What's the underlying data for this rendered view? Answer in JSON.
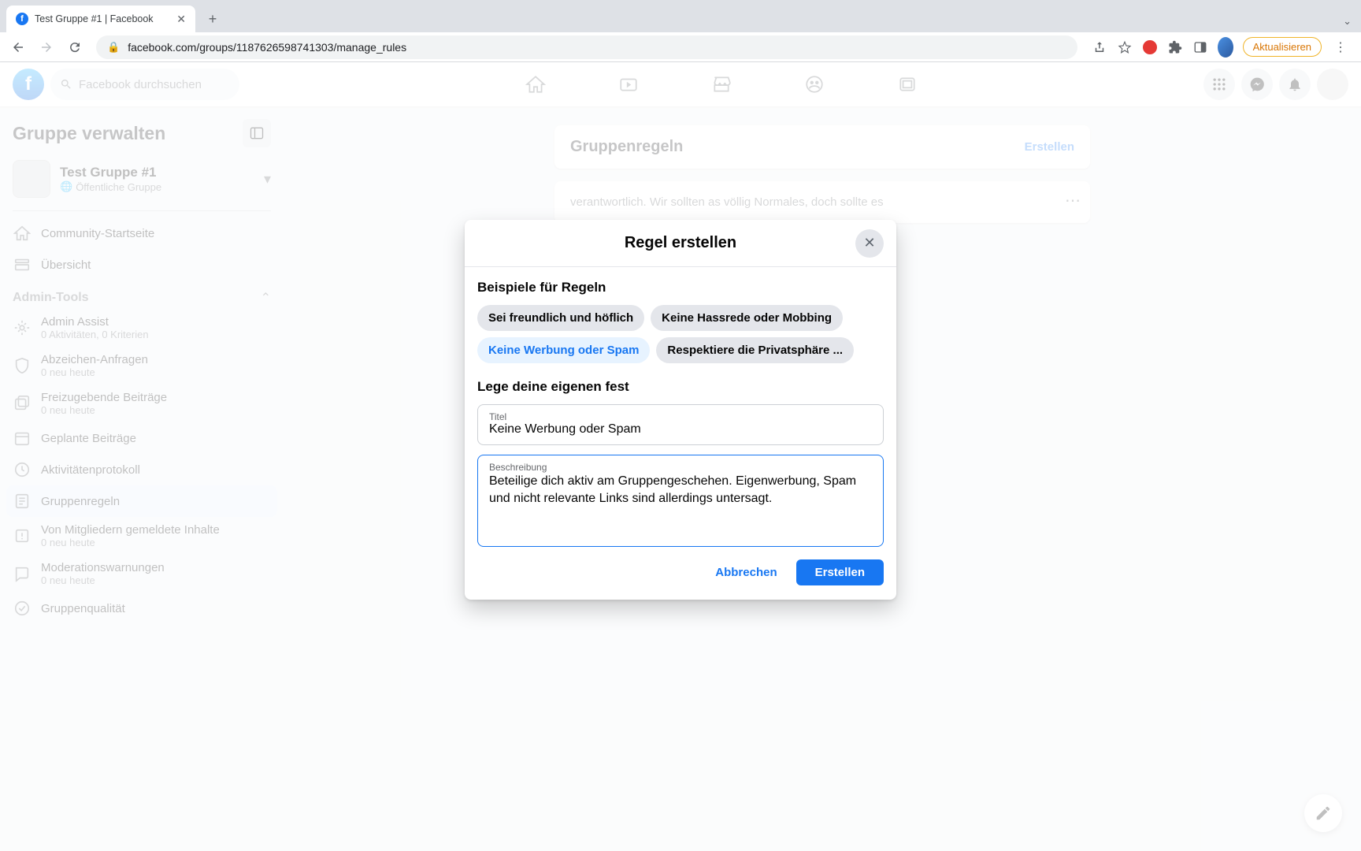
{
  "browser": {
    "tab_title": "Test Gruppe #1 | Facebook",
    "url": "facebook.com/groups/1187626598741303/manage_rules",
    "update_label": "Aktualisieren"
  },
  "fb": {
    "search_placeholder": "Facebook durchsuchen"
  },
  "sidebar": {
    "title": "Gruppe verwalten",
    "group_name": "Test Gruppe #1",
    "group_visibility": "Öffentliche Gruppe",
    "items": [
      {
        "label": "Community-Startseite",
        "sub": ""
      },
      {
        "label": "Übersicht",
        "sub": ""
      }
    ],
    "section_title": "Admin-Tools",
    "admin_items": [
      {
        "label": "Admin Assist",
        "sub": "0 Aktivitäten, 0 Kriterien"
      },
      {
        "label": "Abzeichen-Anfragen",
        "sub": "0 neu heute"
      },
      {
        "label": "Freizugebende Beiträge",
        "sub": "0 neu heute"
      },
      {
        "label": "Geplante Beiträge",
        "sub": ""
      },
      {
        "label": "Aktivitätenprotokoll",
        "sub": ""
      },
      {
        "label": "Gruppenregeln",
        "sub": ""
      },
      {
        "label": "Von Mitgliedern gemeldete Inhalte",
        "sub": "0 neu heute"
      },
      {
        "label": "Moderationswarnungen",
        "sub": "0 neu heute"
      },
      {
        "label": "Gruppenqualität",
        "sub": ""
      }
    ]
  },
  "main": {
    "card_title": "Gruppenregeln",
    "create_label": "Erstellen",
    "rule_snippet": "verantwortlich. Wir sollten as völlig Normales, doch sollte es"
  },
  "modal": {
    "title": "Regel erstellen",
    "examples_title": "Beispiele für Regeln",
    "chips": [
      "Sei freundlich und höflich",
      "Keine Hassrede oder Mobbing",
      "Keine Werbung oder Spam",
      "Respektiere die Privatsphäre ..."
    ],
    "custom_title": "Lege deine eigenen fest",
    "title_label": "Titel",
    "title_value": "Keine Werbung oder Spam",
    "desc_label": "Beschreibung",
    "desc_value": "Beteilige dich aktiv am Gruppengeschehen. Eigenwerbung, Spam und nicht relevante Links sind allerdings untersagt.",
    "cancel": "Abbrechen",
    "submit": "Erstellen"
  }
}
